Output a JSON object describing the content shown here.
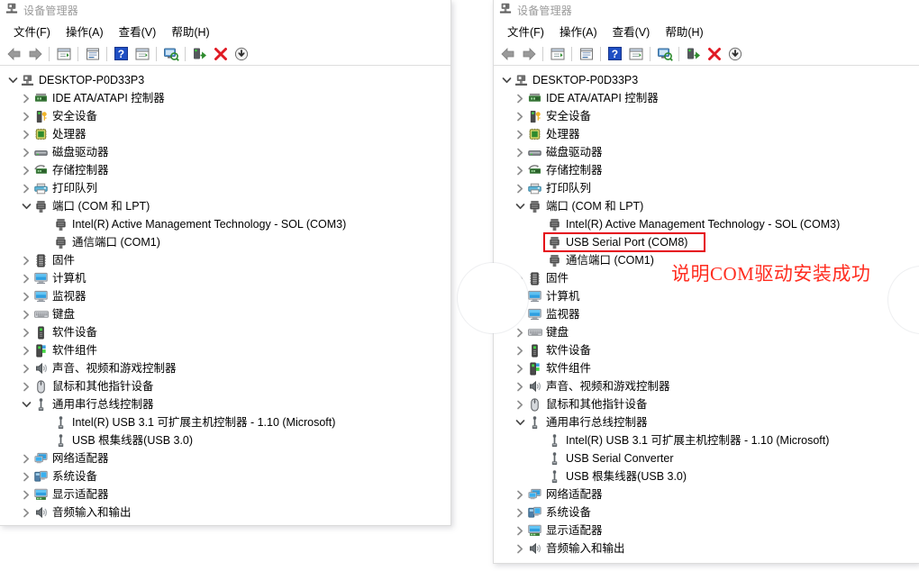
{
  "colors": {
    "annotation_red": "#ff2d20",
    "box_red": "#e50012",
    "title_gray": "#9a9a9a",
    "window_bg": "#ffffff"
  },
  "window_left": {
    "title": "设备管理器",
    "title_icon": "device-manager-icon",
    "menu": [
      {
        "label": "文件(F)",
        "name": "menu-file"
      },
      {
        "label": "操作(A)",
        "name": "menu-action"
      },
      {
        "label": "查看(V)",
        "name": "menu-view"
      },
      {
        "label": "帮助(H)",
        "name": "menu-help"
      }
    ],
    "toolbar": [
      {
        "icon": "back-arrow-icon",
        "tip": "后退"
      },
      {
        "icon": "forward-arrow-icon",
        "tip": "前进"
      },
      {
        "icon": "separator"
      },
      {
        "icon": "show-hidden-tree-icon",
        "tip": "显示/隐藏控制台树"
      },
      {
        "icon": "separator"
      },
      {
        "icon": "properties-icon",
        "tip": "属性"
      },
      {
        "icon": "separator"
      },
      {
        "icon": "help-icon",
        "tip": "帮助"
      },
      {
        "icon": "detail-view-icon",
        "tip": "详细视图"
      },
      {
        "icon": "separator"
      },
      {
        "icon": "scan-hardware-icon",
        "tip": "扫描检测硬件改动"
      },
      {
        "icon": "separator"
      },
      {
        "icon": "update-driver-icon",
        "tip": "更新驱动程序"
      },
      {
        "icon": "uninstall-device-icon",
        "tip": "卸载设备"
      },
      {
        "icon": "disable-device-icon",
        "tip": "禁用设备"
      }
    ],
    "tree": [
      {
        "level": 0,
        "expander": "expanded",
        "icon": "computer-root-icon",
        "label": "DESKTOP-P0D33P3"
      },
      {
        "level": 1,
        "expander": "collapsed",
        "icon": "ide-controller-icon",
        "label": "IDE ATA/ATAPI 控制器"
      },
      {
        "level": 1,
        "expander": "collapsed",
        "icon": "security-device-icon",
        "label": "安全设备"
      },
      {
        "level": 1,
        "expander": "collapsed",
        "icon": "processor-icon",
        "label": "处理器"
      },
      {
        "level": 1,
        "expander": "collapsed",
        "icon": "disk-drive-icon",
        "label": "磁盘驱动器"
      },
      {
        "level": 1,
        "expander": "collapsed",
        "icon": "storage-controller-icon",
        "label": "存储控制器"
      },
      {
        "level": 1,
        "expander": "collapsed",
        "icon": "print-queue-icon",
        "label": "打印队列"
      },
      {
        "level": 1,
        "expander": "expanded",
        "icon": "port-icon",
        "label": "端口 (COM 和 LPT)"
      },
      {
        "level": 2,
        "expander": "none",
        "icon": "port-icon",
        "label": "Intel(R) Active Management Technology - SOL (COM3)"
      },
      {
        "level": 2,
        "expander": "none",
        "icon": "port-icon",
        "label": "通信端口 (COM1)"
      },
      {
        "level": 1,
        "expander": "collapsed",
        "icon": "firmware-icon",
        "label": "固件"
      },
      {
        "level": 1,
        "expander": "collapsed",
        "icon": "computer-icon",
        "label": "计算机"
      },
      {
        "level": 1,
        "expander": "collapsed",
        "icon": "monitor-icon",
        "label": "监视器"
      },
      {
        "level": 1,
        "expander": "collapsed",
        "icon": "keyboard-icon",
        "label": "键盘"
      },
      {
        "level": 1,
        "expander": "collapsed",
        "icon": "software-device-icon",
        "label": "软件设备"
      },
      {
        "level": 1,
        "expander": "collapsed",
        "icon": "software-component-icon",
        "label": "软件组件"
      },
      {
        "level": 1,
        "expander": "collapsed",
        "icon": "sound-video-game-icon",
        "label": "声音、视频和游戏控制器"
      },
      {
        "level": 1,
        "expander": "collapsed",
        "icon": "mouse-icon",
        "label": "鼠标和其他指针设备"
      },
      {
        "level": 1,
        "expander": "expanded",
        "icon": "usb-icon",
        "label": "通用串行总线控制器"
      },
      {
        "level": 2,
        "expander": "none",
        "icon": "usb-icon",
        "label": "Intel(R) USB 3.1 可扩展主机控制器 - 1.10 (Microsoft)"
      },
      {
        "level": 2,
        "expander": "none",
        "icon": "usb-icon",
        "label": "USB 根集线器(USB 3.0)"
      },
      {
        "level": 1,
        "expander": "collapsed",
        "icon": "network-adapter-icon",
        "label": "网络适配器"
      },
      {
        "level": 1,
        "expander": "collapsed",
        "icon": "system-device-icon",
        "label": "系统设备"
      },
      {
        "level": 1,
        "expander": "collapsed",
        "icon": "display-adapter-icon",
        "label": "显示适配器"
      },
      {
        "level": 1,
        "expander": "collapsed",
        "icon": "audio-io-icon",
        "label": "音频输入和输出"
      }
    ]
  },
  "window_right": {
    "title": "设备管理器",
    "title_icon": "device-manager-icon",
    "menu": [
      {
        "label": "文件(F)",
        "name": "menu-file"
      },
      {
        "label": "操作(A)",
        "name": "menu-action"
      },
      {
        "label": "查看(V)",
        "name": "menu-view"
      },
      {
        "label": "帮助(H)",
        "name": "menu-help"
      }
    ],
    "toolbar": [
      {
        "icon": "back-arrow-icon",
        "tip": "后退"
      },
      {
        "icon": "forward-arrow-icon",
        "tip": "前进"
      },
      {
        "icon": "separator"
      },
      {
        "icon": "show-hidden-tree-icon",
        "tip": "显示/隐藏控制台树"
      },
      {
        "icon": "separator"
      },
      {
        "icon": "properties-icon",
        "tip": "属性"
      },
      {
        "icon": "separator"
      },
      {
        "icon": "help-icon",
        "tip": "帮助"
      },
      {
        "icon": "detail-view-icon",
        "tip": "详细视图"
      },
      {
        "icon": "separator"
      },
      {
        "icon": "scan-hardware-icon",
        "tip": "扫描检测硬件改动"
      },
      {
        "icon": "separator"
      },
      {
        "icon": "update-driver-icon",
        "tip": "更新驱动程序"
      },
      {
        "icon": "uninstall-device-icon",
        "tip": "卸载设备"
      },
      {
        "icon": "disable-device-icon",
        "tip": "禁用设备"
      }
    ],
    "tree": [
      {
        "level": 0,
        "expander": "expanded",
        "icon": "computer-root-icon",
        "label": "DESKTOP-P0D33P3"
      },
      {
        "level": 1,
        "expander": "collapsed",
        "icon": "ide-controller-icon",
        "label": "IDE ATA/ATAPI 控制器"
      },
      {
        "level": 1,
        "expander": "collapsed",
        "icon": "security-device-icon",
        "label": "安全设备"
      },
      {
        "level": 1,
        "expander": "collapsed",
        "icon": "processor-icon",
        "label": "处理器"
      },
      {
        "level": 1,
        "expander": "collapsed",
        "icon": "disk-drive-icon",
        "label": "磁盘驱动器"
      },
      {
        "level": 1,
        "expander": "collapsed",
        "icon": "storage-controller-icon",
        "label": "存储控制器"
      },
      {
        "level": 1,
        "expander": "collapsed",
        "icon": "print-queue-icon",
        "label": "打印队列"
      },
      {
        "level": 1,
        "expander": "expanded",
        "icon": "port-icon",
        "label": "端口 (COM 和 LPT)"
      },
      {
        "level": 2,
        "expander": "none",
        "icon": "port-icon",
        "label": "Intel(R) Active Management Technology - SOL (COM3)"
      },
      {
        "level": 2,
        "expander": "none",
        "icon": "port-icon",
        "label": "USB Serial Port (COM8)",
        "highlighted": true
      },
      {
        "level": 2,
        "expander": "none",
        "icon": "port-icon",
        "label": "通信端口 (COM1)"
      },
      {
        "level": 1,
        "expander": "collapsed",
        "icon": "firmware-icon",
        "label": "固件"
      },
      {
        "level": 1,
        "expander": "collapsed",
        "icon": "computer-icon",
        "label": "计算机"
      },
      {
        "level": 1,
        "expander": "collapsed",
        "icon": "monitor-icon",
        "label": "监视器"
      },
      {
        "level": 1,
        "expander": "collapsed",
        "icon": "keyboard-icon",
        "label": "键盘"
      },
      {
        "level": 1,
        "expander": "collapsed",
        "icon": "software-device-icon",
        "label": "软件设备"
      },
      {
        "level": 1,
        "expander": "collapsed",
        "icon": "software-component-icon",
        "label": "软件组件"
      },
      {
        "level": 1,
        "expander": "collapsed",
        "icon": "sound-video-game-icon",
        "label": "声音、视频和游戏控制器"
      },
      {
        "level": 1,
        "expander": "collapsed",
        "icon": "mouse-icon",
        "label": "鼠标和其他指针设备"
      },
      {
        "level": 1,
        "expander": "expanded",
        "icon": "usb-icon",
        "label": "通用串行总线控制器"
      },
      {
        "level": 2,
        "expander": "none",
        "icon": "usb-icon",
        "label": "Intel(R) USB 3.1 可扩展主机控制器 - 1.10 (Microsoft)"
      },
      {
        "level": 2,
        "expander": "none",
        "icon": "usb-icon",
        "label": "USB Serial Converter"
      },
      {
        "level": 2,
        "expander": "none",
        "icon": "usb-icon",
        "label": "USB 根集线器(USB 3.0)"
      },
      {
        "level": 1,
        "expander": "collapsed",
        "icon": "network-adapter-icon",
        "label": "网络适配器"
      },
      {
        "level": 1,
        "expander": "collapsed",
        "icon": "system-device-icon",
        "label": "系统设备"
      },
      {
        "level": 1,
        "expander": "collapsed",
        "icon": "display-adapter-icon",
        "label": "显示适配器"
      },
      {
        "level": 1,
        "expander": "collapsed",
        "icon": "audio-io-icon",
        "label": "音频输入和输出"
      }
    ]
  },
  "annotation": {
    "text": "说明COM驱动安装成功"
  }
}
